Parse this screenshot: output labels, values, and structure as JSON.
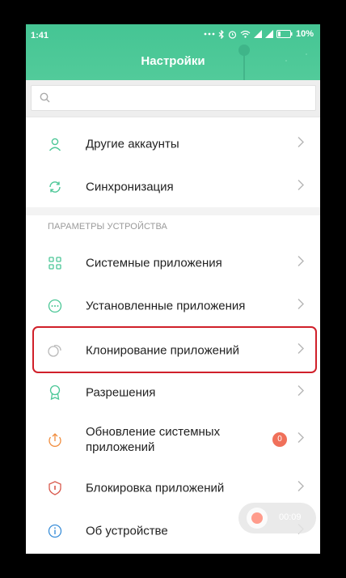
{
  "status_bar": {
    "time": "1:41",
    "battery_percent": "10%",
    "icons": [
      "dots-icon",
      "bluetooth-icon",
      "alarm-icon",
      "wifi-icon",
      "signal-icon",
      "signal-icon",
      "battery-icon"
    ]
  },
  "header": {
    "title": "Настройки",
    "color": "#4cc797"
  },
  "search": {
    "placeholder": "",
    "value": ""
  },
  "account_items": [
    {
      "label": "Другие аккаунты",
      "icon": "person-icon"
    },
    {
      "label": "Синхронизация",
      "icon": "sync-icon"
    }
  ],
  "device_section": {
    "header": "ПАРАМЕТРЫ УСТРОЙСТВА",
    "items": [
      {
        "label": "Системные приложения",
        "icon": "apps-grid-icon"
      },
      {
        "label": "Установленные приложения",
        "icon": "more-circle-icon"
      },
      {
        "label": "Клонирование приложений",
        "icon": "clone-icon",
        "highlighted": true
      },
      {
        "label": "Разрешения",
        "icon": "badge-icon"
      },
      {
        "label": "Обновление системных приложений",
        "icon": "update-icon",
        "badge": "0"
      },
      {
        "label": "Блокировка приложений",
        "icon": "shield-icon"
      },
      {
        "label": "Об устройстве",
        "icon": "info-icon"
      }
    ]
  },
  "recorder": {
    "time": "00:09"
  },
  "colors": {
    "accent": "#4cc797",
    "highlight": "#d0202a",
    "badge": "#f0705a"
  }
}
